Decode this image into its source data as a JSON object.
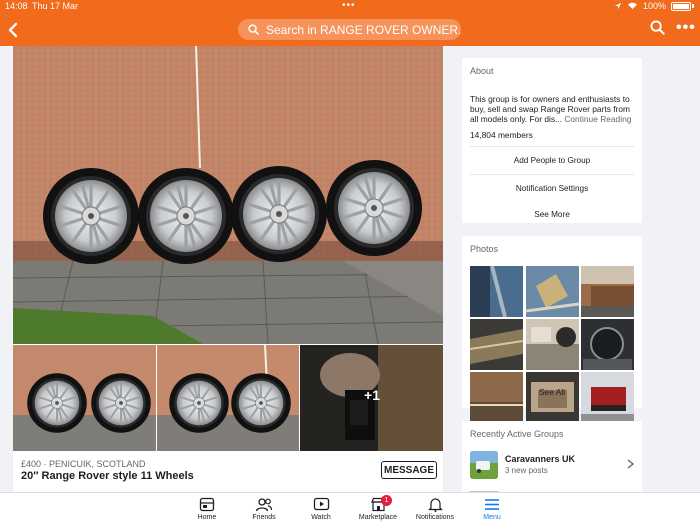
{
  "status_bar": {
    "time": "14:08",
    "date": "Thu 17 Mar",
    "battery": "100%"
  },
  "header": {
    "search_placeholder": "Search in RANGE ROVER OWNER...",
    "accent_color": "#f26a1b"
  },
  "post": {
    "price_location": "£400 · PENICUIK, SCOTLAND",
    "title": "20″ Range Rover style 11 Wheels",
    "message_label": "MESSAGE",
    "more_photos": "+1"
  },
  "about": {
    "heading": "About",
    "description": "This group is for owners and enthusiasts to buy, sell and swap Range Rover parts from all models only. For dis...",
    "continue_label": "Continue Reading",
    "members": "14,804 members",
    "add_people": "Add People to Group",
    "notification_settings": "Notification Settings",
    "see_more": "See More"
  },
  "photos": {
    "heading": "Photos",
    "see_all": "See All"
  },
  "recent_groups": {
    "heading": "Recently Active Groups",
    "items": [
      {
        "name": "Caravanners UK",
        "sub": "3 new posts"
      }
    ]
  },
  "bottom_nav": {
    "items": [
      {
        "label": "Home",
        "icon": "home-icon"
      },
      {
        "label": "Friends",
        "icon": "friends-icon"
      },
      {
        "label": "Watch",
        "icon": "watch-icon"
      },
      {
        "label": "Marketplace",
        "icon": "marketplace-icon",
        "badge": "1"
      },
      {
        "label": "Notifications",
        "icon": "bell-icon"
      },
      {
        "label": "Menu",
        "icon": "menu-icon",
        "active": true
      }
    ],
    "active_color": "#1877f2"
  }
}
